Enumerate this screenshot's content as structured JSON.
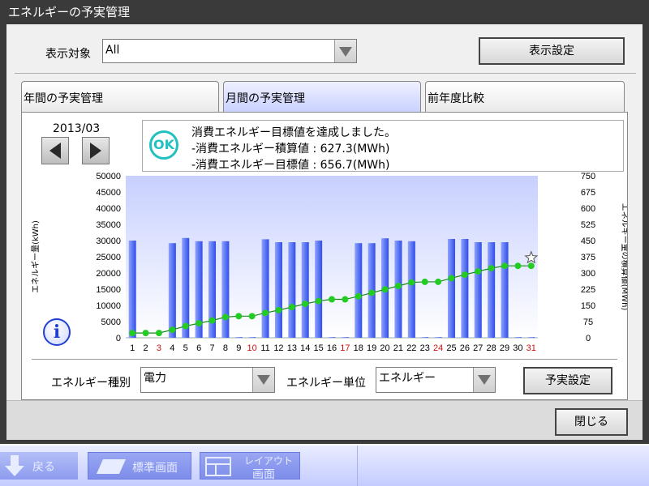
{
  "window": {
    "title": "エネルギーの予実管理"
  },
  "header": {
    "target_label": "表示対象",
    "target_value": "All",
    "display_settings_label": "表示設定"
  },
  "tabs": [
    {
      "label": "年間の予実管理"
    },
    {
      "label": "月間の予実管理"
    },
    {
      "label": "前年度比較"
    }
  ],
  "period": {
    "label": "2013/03"
  },
  "message": {
    "status": "OK",
    "line1": "消費エネルギー目標値を達成しました。",
    "line2": "-消費エネルギー積算値 : 627.3(MWh)",
    "line3": "-消費エネルギー目標値 : 656.7(MWh)"
  },
  "footer_controls": {
    "energy_type_label": "エネルギー種別",
    "energy_type_value": "電力",
    "energy_unit_label": "エネルギー単位",
    "energy_unit_value": "エネルギー",
    "budget_settings_label": "予実設定"
  },
  "close_label": "閉じる",
  "taskbar": {
    "back_label": "戻る",
    "standard_label": "標準画面",
    "layout_label_1": "レイアウト",
    "layout_label_2": "画面"
  },
  "colors": {
    "bar": "#3f5ff0",
    "line": "#22cc22",
    "red_day": "#d01010",
    "ok": "#23c0c0"
  },
  "chart_data": {
    "type": "bar",
    "categories": [
      "1",
      "2",
      "3",
      "4",
      "5",
      "6",
      "7",
      "8",
      "9",
      "10",
      "11",
      "12",
      "13",
      "14",
      "15",
      "16",
      "17",
      "18",
      "19",
      "20",
      "21",
      "22",
      "23",
      "24",
      "25",
      "26",
      "27",
      "28",
      "29",
      "30",
      "31"
    ],
    "red_days": [
      "3",
      "10",
      "17",
      "24",
      "31"
    ],
    "series": [
      {
        "kind": "bar",
        "axis": "left",
        "values": [
          30000,
          0,
          0,
          29200,
          30800,
          29800,
          29800,
          29800,
          200,
          200,
          30400,
          29500,
          29500,
          29500,
          30000,
          200,
          200,
          29200,
          29200,
          30700,
          30000,
          29800,
          200,
          200,
          30500,
          30500,
          29500,
          29500,
          29500,
          200,
          200
        ]
      },
      {
        "kind": "line",
        "axis": "right",
        "values": [
          22,
          22,
          22,
          37,
          54,
          67,
          80,
          96,
          100,
          100,
          115,
          128,
          142,
          157,
          170,
          178,
          178,
          192,
          208,
          224,
          240,
          256,
          259,
          259,
          276,
          292,
          307,
          322,
          333,
          333,
          333
        ]
      }
    ],
    "ylabel": "エネルギー量(kWh)",
    "y2label": "エネルギー量の積算値(MWh)",
    "ylim": [
      0,
      50000
    ],
    "y2lim": [
      0,
      750
    ],
    "yticks": [
      0,
      5000,
      10000,
      15000,
      20000,
      25000,
      30000,
      35000,
      40000,
      45000,
      50000
    ],
    "y2ticks": [
      0,
      75,
      150,
      225,
      300,
      375,
      450,
      525,
      600,
      675,
      750
    ],
    "grid": false,
    "target_marker": "star"
  }
}
